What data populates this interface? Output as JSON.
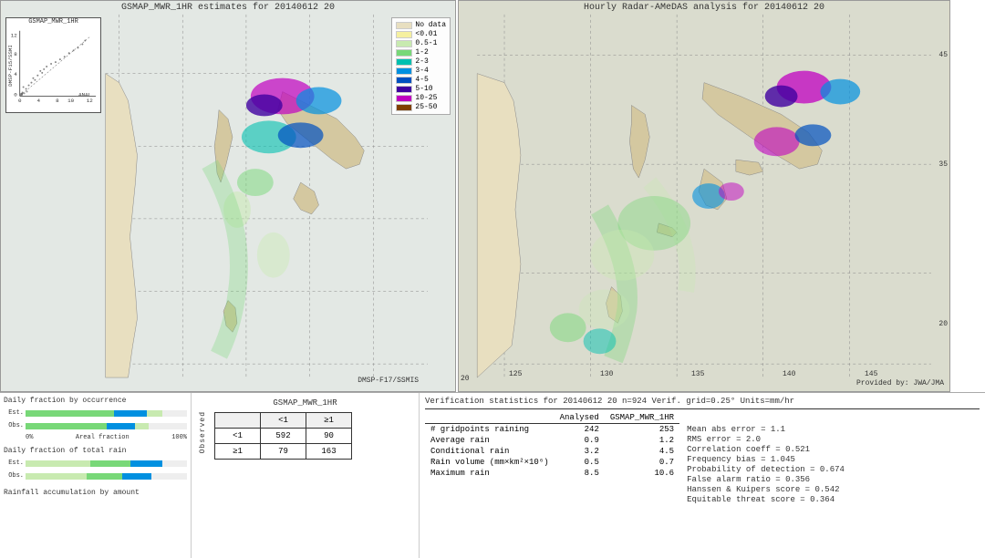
{
  "left_panel": {
    "title": "GSMAP_MWR_1HR estimates for 20140612 20",
    "dmsp_y_label": "DMSP-F15/SSMI",
    "dmsp_x_label": "ANAL",
    "dmsp_bottom": "DMSP-F17/SSMIS",
    "scatter_title": "GSMAP_MWR_1HR",
    "scatter_axis_ticks_y": [
      "0",
      "4",
      "8",
      "12"
    ],
    "scatter_axis_ticks_x": [
      "0",
      "4",
      "8",
      "10",
      "12"
    ]
  },
  "legend": {
    "title": "",
    "items": [
      {
        "label": "No data",
        "color": "#e8dfc0"
      },
      {
        "label": "<0.01",
        "color": "#f5f0a0"
      },
      {
        "label": "0.5-1",
        "color": "#c8eab0"
      },
      {
        "label": "1-2",
        "color": "#78d878"
      },
      {
        "label": "2-3",
        "color": "#00c0b0"
      },
      {
        "label": "3-4",
        "color": "#0090e0"
      },
      {
        "label": "4-5",
        "color": "#0050c0"
      },
      {
        "label": "5-10",
        "color": "#4000a0"
      },
      {
        "label": "10-25",
        "color": "#c000c0"
      },
      {
        "label": "25-50",
        "color": "#804000"
      }
    ]
  },
  "right_panel": {
    "title": "Hourly Radar-AMeDAS analysis for 20140612 20",
    "credit": "Provided by: JWA/JMA",
    "lat_labels": [
      "45",
      "35",
      "20"
    ],
    "lon_labels": [
      "125",
      "130",
      "135",
      "140",
      "145"
    ]
  },
  "bottom_left": {
    "bar_chart1_title": "Daily fraction by occurrence",
    "bar_chart2_title": "Daily fraction of total rain",
    "bar_footer": "Rainfall accumulation by amount",
    "axis_start": "0%",
    "axis_end": "100%",
    "axis_mid": "Areal fraction",
    "labels": [
      "Est.",
      "Obs."
    ],
    "labels2": [
      "Est.",
      "Obs."
    ]
  },
  "contingency": {
    "title": "GSMAP_MWR_1HR",
    "header_col": [
      "<1",
      "≥1"
    ],
    "row_labels": [
      "<1",
      "≥1"
    ],
    "obs_label": "O\nb\ns\ne\nr\nv\ne\nd",
    "values": [
      [
        592,
        90
      ],
      [
        79,
        163
      ]
    ],
    "side_label_top": "<1",
    "side_label_bot": "≥1"
  },
  "verification": {
    "title": "Verification statistics for 20140612 20  n=924  Verif. grid=0.25°  Units=mm/hr",
    "table_headers": [
      "",
      "Analysed",
      "GSMAP_MWR_1HR"
    ],
    "rows": [
      {
        "label": "# gridpoints raining",
        "analysed": "242",
        "gsmap": "253"
      },
      {
        "label": "Average rain",
        "analysed": "0.9",
        "gsmap": "1.2"
      },
      {
        "label": "Conditional rain",
        "analysed": "3.2",
        "gsmap": "4.5"
      },
      {
        "label": "Rain volume (mm×km²×10⁶)",
        "analysed": "0.5",
        "gsmap": "0.7"
      },
      {
        "label": "Maximum rain",
        "analysed": "8.5",
        "gsmap": "10.6"
      }
    ],
    "scores": [
      "Mean abs error = 1.1",
      "RMS error = 2.0",
      "Correlation coeff = 0.521",
      "Frequency bias = 1.045",
      "Probability of detection = 0.674",
      "False alarm ratio = 0.356",
      "Hanssen & Kuipers score = 0.542",
      "Equitable threat score = 0.364"
    ]
  }
}
